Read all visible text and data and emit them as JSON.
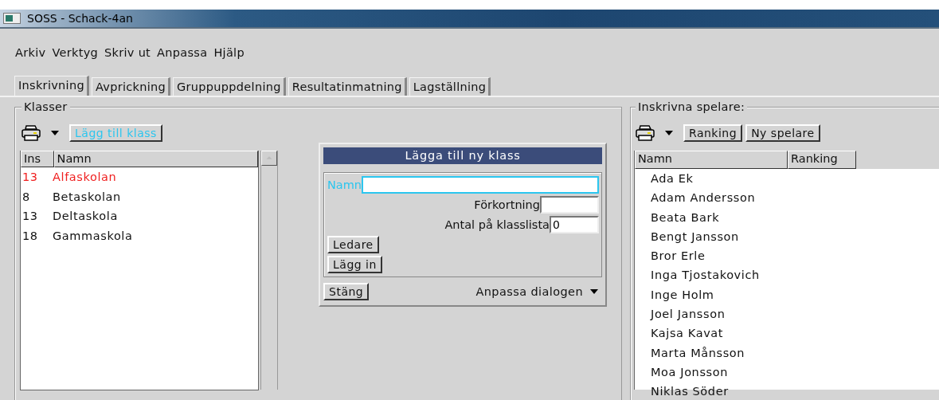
{
  "window": {
    "title": "SOSS - Schack-4an"
  },
  "menu": [
    "Arkiv",
    "Verktyg",
    "Skriv ut",
    "Anpassa",
    "Hjälp"
  ],
  "tabs": [
    {
      "label": "Inskrivning",
      "selected": true
    },
    {
      "label": "Avprickning",
      "selected": false
    },
    {
      "label": "Gruppuppdelning",
      "selected": false
    },
    {
      "label": "Resultatinmatning",
      "selected": false
    },
    {
      "label": "Lagställning",
      "selected": false
    }
  ],
  "classes_panel": {
    "title": "Klasser",
    "buttons": [
      {
        "label": "Lägg till klass",
        "highlighted": true
      }
    ],
    "columns": [
      "Ins",
      "Namn"
    ],
    "rows": [
      {
        "ins": "13",
        "name": "Alfaskolan",
        "selected": true
      },
      {
        "ins": "8",
        "name": "Betaskolan",
        "selected": false
      },
      {
        "ins": "13",
        "name": "Deltaskola",
        "selected": false
      },
      {
        "ins": "18",
        "name": "Gammaskola",
        "selected": false
      }
    ]
  },
  "dialog": {
    "title": "Lägga till ny klass",
    "fields": [
      {
        "label": "Namn",
        "focused": true
      },
      {
        "label": "Förkortning",
        "focused": false
      },
      {
        "label": "Antal på klasslista",
        "value": "0",
        "focused": false
      }
    ],
    "buttons": [
      "Ledare",
      "Lägg in"
    ],
    "close_button": "Stäng",
    "customize": "Anpassa dialogen"
  },
  "players_panel": {
    "title": "Inskrivna spelare:",
    "buttons": [
      {
        "label": "Ranking",
        "highlighted": false
      },
      {
        "label": "Ny spelare",
        "highlighted": false
      }
    ],
    "columns": [
      "Namn",
      "Ranking"
    ],
    "rows": [
      "Ada Ek",
      "Adam Andersson",
      "Beata Bark",
      "Bengt Jansson",
      "Bror Erle",
      "Inga Tjostakovich",
      "Inge Holm",
      "Joel Jansson",
      "Kajsa Kavat",
      "Marta Månsson",
      "Moa Jonsson",
      "Niklas Söder"
    ]
  }
}
